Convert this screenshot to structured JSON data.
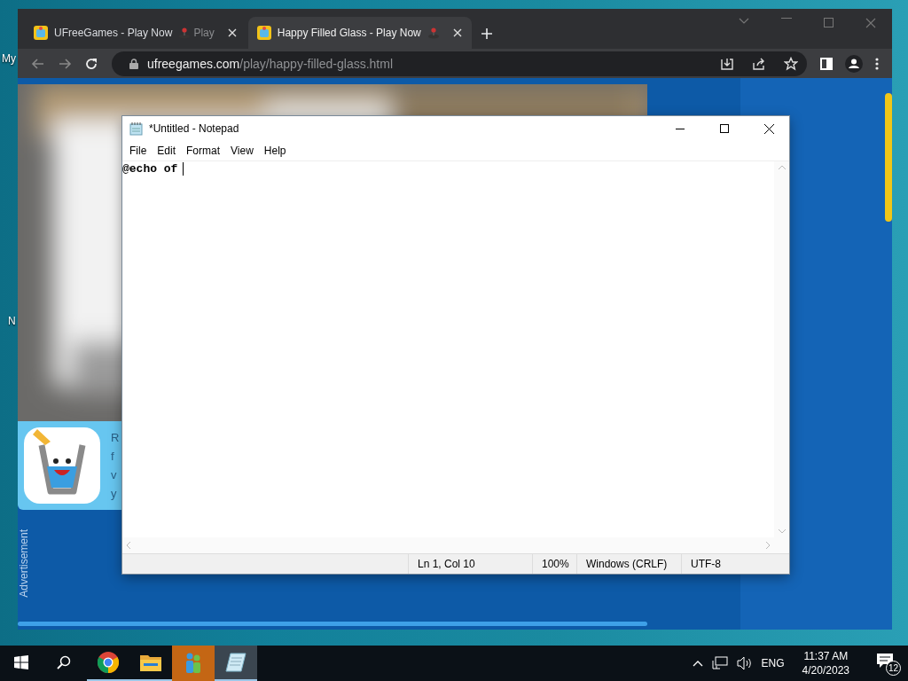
{
  "desktop": {
    "icon_labels": [
      "My",
      "N"
    ]
  },
  "browser": {
    "tabs": [
      {
        "title": "UFreeGames - Play Now",
        "after_icon": "Play",
        "selected": false
      },
      {
        "title": "Happy Filled Glass - Play Now",
        "selected": true
      }
    ],
    "address": {
      "domain": "ufreegames.com",
      "path": "/play/happy-filled-glass.html"
    },
    "page": {
      "ad_lines": [
        "R",
        "f",
        "v",
        "y"
      ],
      "side_label": "Advertisement"
    }
  },
  "notepad": {
    "title": "*Untitled - Notepad",
    "menu": [
      "File",
      "Edit",
      "Format",
      "View",
      "Help"
    ],
    "text": "@echo of",
    "status": [
      "Ln 1, Col 10",
      "100%",
      "Windows (CRLF)",
      "UTF-8"
    ]
  },
  "taskbar": {
    "apps": [
      {
        "kind": "chrome",
        "open": true,
        "flashing": false,
        "selected": false
      },
      {
        "kind": "explorer",
        "open": true,
        "flashing": false,
        "selected": false
      },
      {
        "kind": "app",
        "open": false,
        "flashing": true,
        "selected": false
      },
      {
        "kind": "notepad",
        "open": true,
        "flashing": false,
        "selected": true
      }
    ],
    "language": "ENG",
    "time": "11:37 AM",
    "date": "4/20/2023",
    "notifications": "12"
  }
}
